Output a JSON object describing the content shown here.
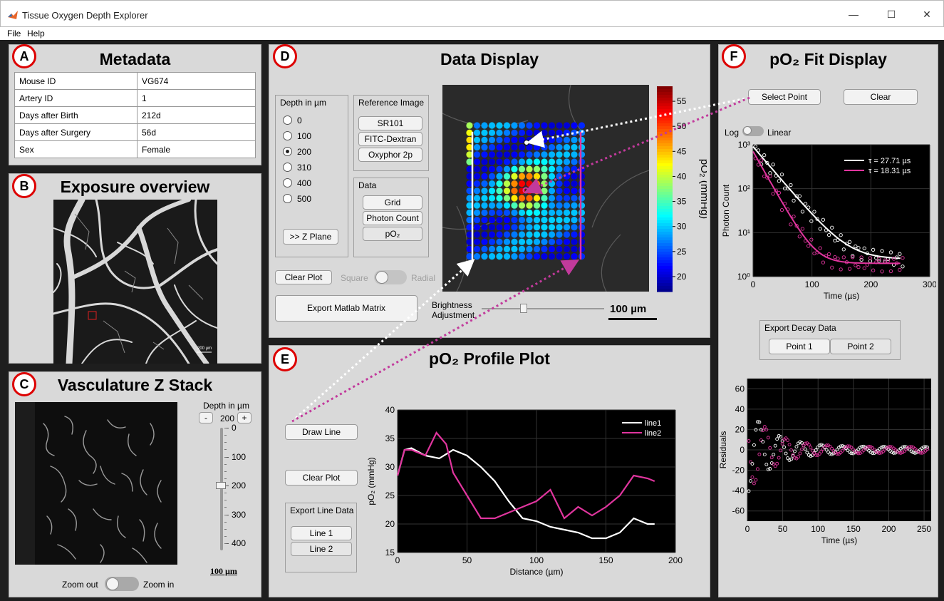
{
  "window": {
    "title": "Tissue Oxygen Depth Explorer",
    "minimize": "—",
    "maximize": "☐",
    "close": "✕"
  },
  "menu": [
    "File",
    "Help"
  ],
  "colors": {
    "badge_ring": "#dd0000",
    "line2": "#e0359e",
    "panel_bg": "#d9d9d9",
    "frame": "#1e1e1e"
  },
  "metadata": {
    "badge": "A",
    "title": "Metadata",
    "rows": [
      {
        "key": "Mouse ID",
        "value": "VG674"
      },
      {
        "key": "Artery ID",
        "value": "1"
      },
      {
        "key": "Days after Birth",
        "value": "212d"
      },
      {
        "key": "Days after Surgery",
        "value": "56d"
      },
      {
        "key": "Sex",
        "value": "Female"
      }
    ]
  },
  "exposure": {
    "badge": "B",
    "title": "Exposure overview",
    "scale": "200 µm"
  },
  "zstack": {
    "badge": "C",
    "title": "Vasculature Z Stack",
    "depth_label": "Depth in µm",
    "minus": "-",
    "plus": "+",
    "depth_value": "200",
    "ticks": [
      "0",
      "100",
      "200",
      "300",
      "400"
    ],
    "slider_depth": 200,
    "scale": "100 µm",
    "zoom_out": "Zoom out",
    "zoom_in": "Zoom in"
  },
  "data_display": {
    "badge": "D",
    "title": "Data Display",
    "depth_group": "Depth in µm",
    "depths": [
      "0",
      "100",
      "200",
      "310",
      "400",
      "500"
    ],
    "selected_depth": "200",
    "z_plane_button": ">> Z Plane",
    "reference_group": "Reference Image",
    "reference_buttons": [
      "SR101",
      "FITC-Dextran",
      "Oxyphor 2p"
    ],
    "data_group": "Data",
    "data_buttons": [
      "Grid",
      "Photon Count",
      "pO₂"
    ],
    "clear_plot": "Clear Plot",
    "square": "Square",
    "radial": "Radial",
    "export_matlab": "Export Matlab Matrix",
    "brightness_line1": "Brightness",
    "brightness_line2": "Adjustment",
    "scale": "100 µm",
    "colorbar_ticks": [
      "55",
      "50",
      "45",
      "40",
      "35",
      "30",
      "25",
      "20"
    ],
    "colorbar_label": "pO₂ (mmHg)",
    "colorbar_range": [
      17,
      58
    ]
  },
  "profile": {
    "badge": "E",
    "title": "pO₂ Profile Plot",
    "draw_line": "Draw Line",
    "clear_plot": "Clear Plot",
    "export_group": "Export Line Data",
    "line_buttons": [
      "Line 1",
      "Line 2"
    ]
  },
  "fit_display": {
    "badge": "F",
    "title": "pO₂ Fit Display",
    "select_point": "Select Point",
    "clear": "Clear",
    "log": "Log",
    "linear": "Linear",
    "export_group": "Export Decay Data",
    "point_buttons": [
      "Point 1",
      "Point 2"
    ]
  },
  "chart_data": [
    {
      "type": "line",
      "xlabel": "Distance (µm)",
      "ylabel": "pO₂ (mmHg)",
      "xlim": [
        0,
        200
      ],
      "ylim": [
        15,
        40
      ],
      "xticks": [
        "0",
        "50",
        "100",
        "150",
        "200"
      ],
      "yticks": [
        "15",
        "20",
        "25",
        "30",
        "35",
        "40"
      ],
      "legend": "top-right",
      "series": [
        {
          "name": "line1",
          "color": "#ffffff",
          "x": [
            0,
            5,
            10,
            20,
            30,
            40,
            50,
            60,
            70,
            80,
            90,
            100,
            110,
            120,
            130,
            140,
            150,
            160,
            170,
            180,
            185
          ],
          "y": [
            28.5,
            33,
            33.3,
            32,
            31.5,
            33,
            32,
            30,
            27.5,
            24,
            21,
            20.5,
            19.5,
            19,
            18.5,
            17.5,
            17.5,
            18.5,
            21,
            20,
            20
          ]
        },
        {
          "name": "line2",
          "color": "#e0359e",
          "x": [
            0,
            5,
            10,
            20,
            28,
            35,
            40,
            50,
            60,
            65,
            70,
            80,
            90,
            100,
            110,
            120,
            130,
            140,
            150,
            160,
            170,
            180,
            185
          ],
          "y": [
            28.5,
            33,
            33,
            32,
            36,
            34,
            29,
            25,
            21,
            21,
            21,
            22,
            23,
            24,
            26,
            21,
            23,
            21.5,
            23,
            25,
            28.5,
            28,
            27.5
          ]
        }
      ]
    },
    {
      "type": "scatter",
      "xlabel": "Time (µs)",
      "ylabel": "Photon Count",
      "yscale": "log",
      "xlim": [
        0,
        300
      ],
      "ylim": [
        1,
        1000
      ],
      "xticks": [
        "0",
        "100",
        "200",
        "300"
      ],
      "yticks": [
        "10⁰",
        "10¹",
        "10²",
        "10³"
      ],
      "legend": "top-right",
      "series": [
        {
          "name": "τ = 27.71 µs",
          "color": "#ffffff",
          "tau": 27.71
        },
        {
          "name": "τ = 18.31 µs",
          "color": "#e0359e",
          "tau": 18.31
        }
      ]
    },
    {
      "type": "scatter",
      "xlabel": "Time (µs)",
      "ylabel": "Residuals",
      "xlim": [
        0,
        260
      ],
      "ylim": [
        -70,
        70
      ],
      "xticks": [
        "0",
        "50",
        "100",
        "150",
        "200",
        "250"
      ],
      "yticks": [
        "60",
        "40",
        "20",
        "0",
        "-20",
        "-40",
        "-60"
      ]
    }
  ]
}
